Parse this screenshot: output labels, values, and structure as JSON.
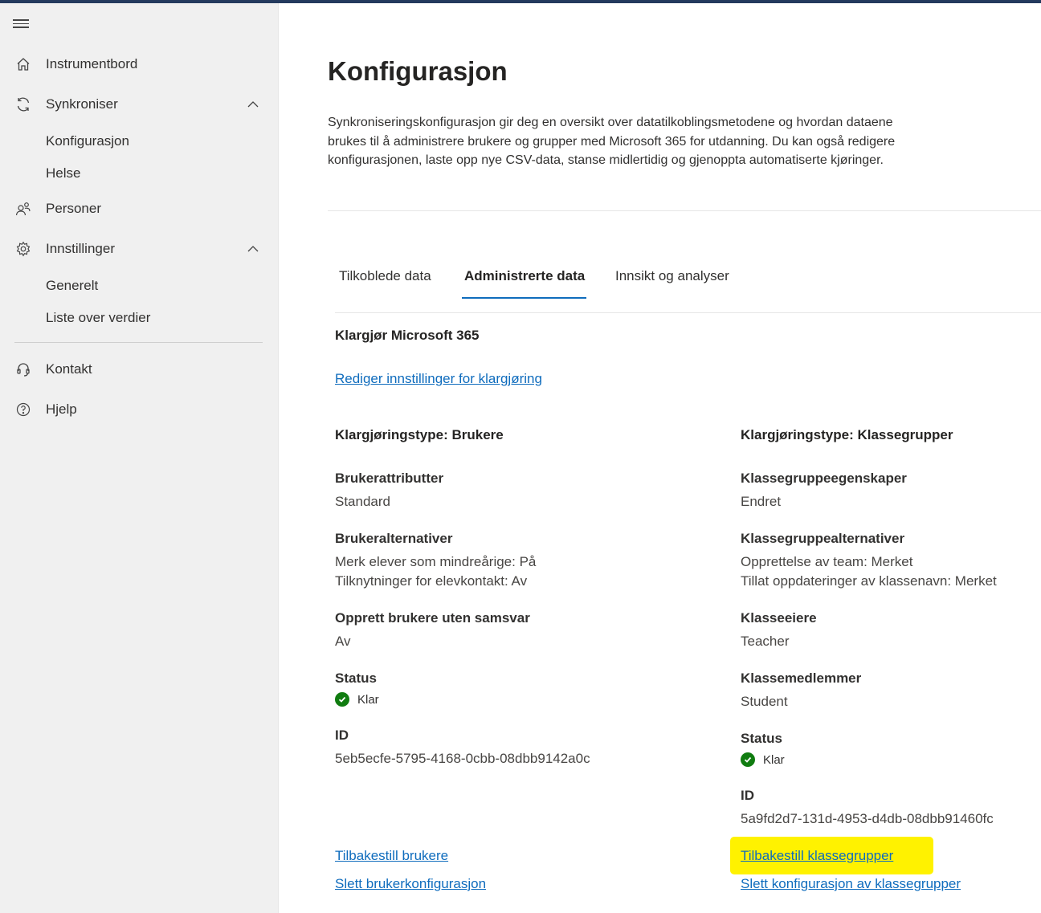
{
  "sidebar": {
    "items": [
      {
        "label": "Instrumentbord"
      },
      {
        "label": "Synkroniser"
      },
      {
        "label": "Personer"
      },
      {
        "label": "Innstillinger"
      },
      {
        "label": "Kontakt"
      },
      {
        "label": "Hjelp"
      }
    ],
    "sync_sub": [
      "Konfigurasjon",
      "Helse"
    ],
    "settings_sub": [
      "Generelt",
      "Liste over verdier"
    ]
  },
  "page": {
    "title": "Konfigurasjon",
    "description": "Synkroniseringskonfigurasjon gir deg en oversikt over datatilkoblingsmetodene og hvordan dataene brukes til å administrere brukere og grupper med Microsoft 365 for utdanning. Du kan også redigere konfigurasjonen, laste opp nye CSV-data, stanse midlertidig og gjenoppta automatiserte kjøringer."
  },
  "tabs": [
    "Tilkoblede data",
    "Administrerte data",
    "Innsikt og analyser"
  ],
  "active_tab": "Administrerte data",
  "section": {
    "title": "Klargjør Microsoft 365",
    "edit_link": "Rediger innstillinger for klargjøring"
  },
  "users": {
    "heading": "Klargjøringstype: Brukere",
    "attr_label": "Brukerattributter",
    "attr_value": "Standard",
    "opt_label": "Brukeralternativer",
    "opt_values": [
      "Merk elever som mindreårige: På",
      "Tilknytninger for elevkontakt: Av"
    ],
    "unmatched_label": "Opprett brukere uten samsvar",
    "unmatched_value": "Av",
    "status_label": "Status",
    "status_value": "Klar",
    "id_label": "ID",
    "id_value": "5eb5ecfe-5795-4168-0cbb-08dbb9142a0c",
    "reset_link": "Tilbakestill brukere",
    "delete_link": "Slett brukerkonfigurasjon"
  },
  "classgroups": {
    "heading": "Klargjøringstype: Klassegrupper",
    "props_label": "Klassegruppeegenskaper",
    "props_value": "Endret",
    "opt_label": "Klassegruppealternativer",
    "opt_values": [
      "Opprettelse av team: Merket",
      "Tillat oppdateringer av klassenavn: Merket"
    ],
    "owners_label": "Klasseeiere",
    "owners_value": "Teacher",
    "members_label": "Klassemedlemmer",
    "members_value": "Student",
    "status_label": "Status",
    "status_value": "Klar",
    "id_label": "ID",
    "id_value": "5a9fd2d7-131d-4953-d4db-08dbb91460fc",
    "reset_link": "Tilbakestill klassegrupper",
    "delete_link": "Slett konfigurasjon av klassegrupper"
  },
  "colors": {
    "accent": "#0f6cbd",
    "status_ok": "#107c10",
    "highlight": "#fff200",
    "sidebar_bg": "#f0f0f0"
  }
}
